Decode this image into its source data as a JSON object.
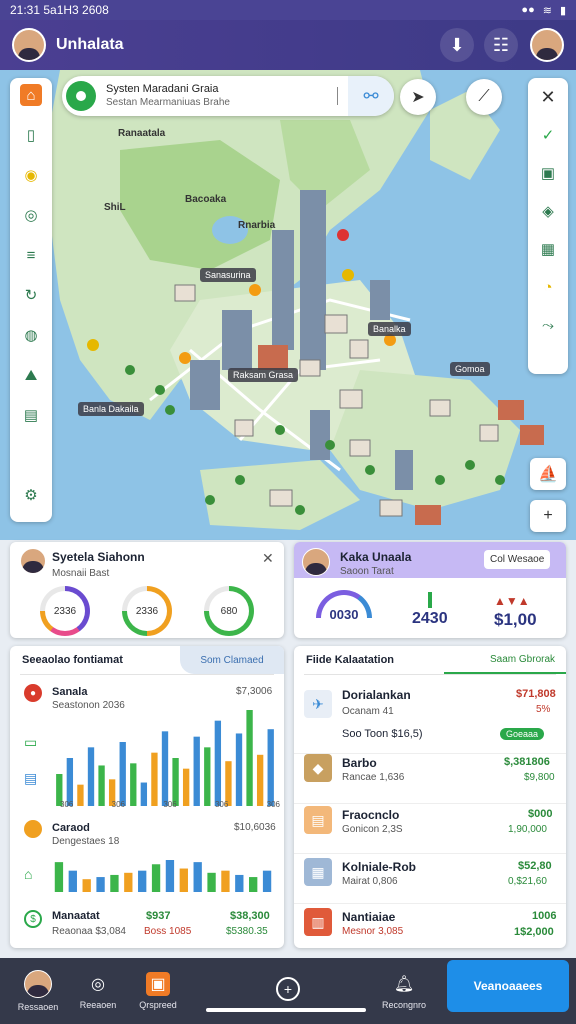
{
  "status": {
    "time": "21:31 5a1H3 2608",
    "right": "..."
  },
  "header": {
    "title": "Unhalata"
  },
  "search": {
    "title": "Systen Maradani Graia",
    "subtitle": "Sestan Mearmaniuas Brahe"
  },
  "map": {
    "labels": [
      "Banla Dakaila",
      "Sanasurina",
      "Banalka",
      "Raksam Grasa",
      "Gomoa"
    ],
    "names": [
      "Ranaatala",
      "Bacoaka",
      "ShiL",
      "Rnarbia"
    ]
  },
  "cards": {
    "summary": {
      "title": "Syetela Siahonn",
      "subtitle": "Mosnaii Bast",
      "gauges": [
        "2336",
        "2336",
        "680"
      ],
      "gauge_colors": [
        "#6a4bd0",
        "#f0a020",
        "#3cb54a"
      ]
    },
    "profile": {
      "title": "Kaka Unaala",
      "subtitle": "Saoon Tarat",
      "button": "Col Wesaoe",
      "values": [
        "0030",
        "2430",
        "$1,00"
      ]
    },
    "chart_card": {
      "header": "Seeaolao fontiamat",
      "tag": "Som Clamaed",
      "item1": {
        "title": "Sanala",
        "sub": "Seastonon 2036",
        "value": "$7,3006"
      },
      "item2": {
        "title": "Caraod",
        "sub": "Dengestaes 18",
        "value": "$10,6036"
      },
      "item3": {
        "title": "Manaatat",
        "sub": "Reaonaa $3,084",
        "v1": "$937",
        "v2": "$38,300",
        "v3": "Boss 1085",
        "v4": "$5380.35"
      }
    },
    "list_card": {
      "header": "Fiide Kalaatation",
      "tag": "Saam Gbrorak",
      "items": [
        {
          "title": "Dorialankan",
          "sub": "Ocanam 41",
          "v1": "$71,808",
          "v2": "5%"
        },
        {
          "title": "Barbo",
          "sub": "Rancae 1,636",
          "v1": "$,381806",
          "v2": "$9,800"
        },
        {
          "title": "Fraocnclo",
          "sub": "Gonicon 2,3S",
          "v1": "$000",
          "v2": "1,90,000"
        },
        {
          "title": "Kolniale-Rob",
          "sub": "Mairat 0,806",
          "v1": "$52,80",
          "v2": "0,$21,60"
        },
        {
          "title": "Nantiaiae",
          "sub": "Mesnor 3,085",
          "v1": "1006",
          "v2": "1$2,000"
        }
      ],
      "sub_row": {
        "label": "Soo Toon $16,5)",
        "badge": "Goeaaa"
      }
    }
  },
  "chart_data": [
    {
      "type": "bar",
      "categories": [
        "306",
        "306",
        "306",
        "306",
        "306"
      ],
      "series": [
        {
          "values": [
            30,
            45,
            20,
            55,
            38,
            25,
            60,
            40,
            22,
            50,
            70,
            45,
            35,
            65,
            55,
            80,
            42,
            68,
            90,
            48,
            72
          ]
        }
      ]
    },
    {
      "type": "bar",
      "series": [
        {
          "values": [
            28,
            20,
            12,
            14,
            16,
            18,
            20,
            26,
            30,
            22,
            28,
            18,
            20,
            16,
            14,
            20
          ]
        }
      ]
    }
  ],
  "nav": [
    "Ressaoen",
    "Reeaoen",
    "Qrspreed",
    "",
    "Recongnro"
  ],
  "cta": "Veanoaaees"
}
